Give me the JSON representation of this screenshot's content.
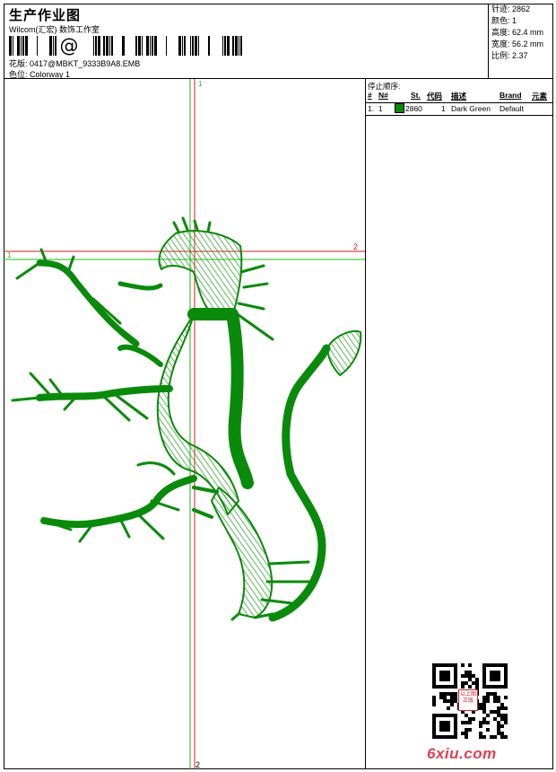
{
  "header": {
    "title": "生产作业图",
    "subtitle": "Wilcom(汇宏) 数饰工作室",
    "design_label": "花版:",
    "design_value": "0417@MBKT_9333B9A8.EMB",
    "colorway_label": "色位:",
    "colorway_value": "Colorway 1"
  },
  "stats": {
    "stitches": "针迹: 2862",
    "colors": "颜色: 1",
    "height": "高度: 62.4 mm",
    "width": "宽度: 56.2 mm",
    "scale": "比例: 2.37"
  },
  "canvas": {
    "guide_v1": "1",
    "guide_v2": "2",
    "guide_h1": "1",
    "guide_h2": "2",
    "thread_color": "#0a8a0a"
  },
  "sequence_panel": {
    "title": "停止顺序:",
    "columns": [
      "#",
      "N#",
      "St.",
      "代码",
      "描述",
      "Brand",
      "元素"
    ],
    "row": {
      "index": "1.",
      "n": "1",
      "stitches": "2860",
      "code": "1",
      "description": "Dark Green",
      "brand": "Default"
    }
  },
  "watermark": "6xiu.com",
  "seal_text": "以上图 正版"
}
